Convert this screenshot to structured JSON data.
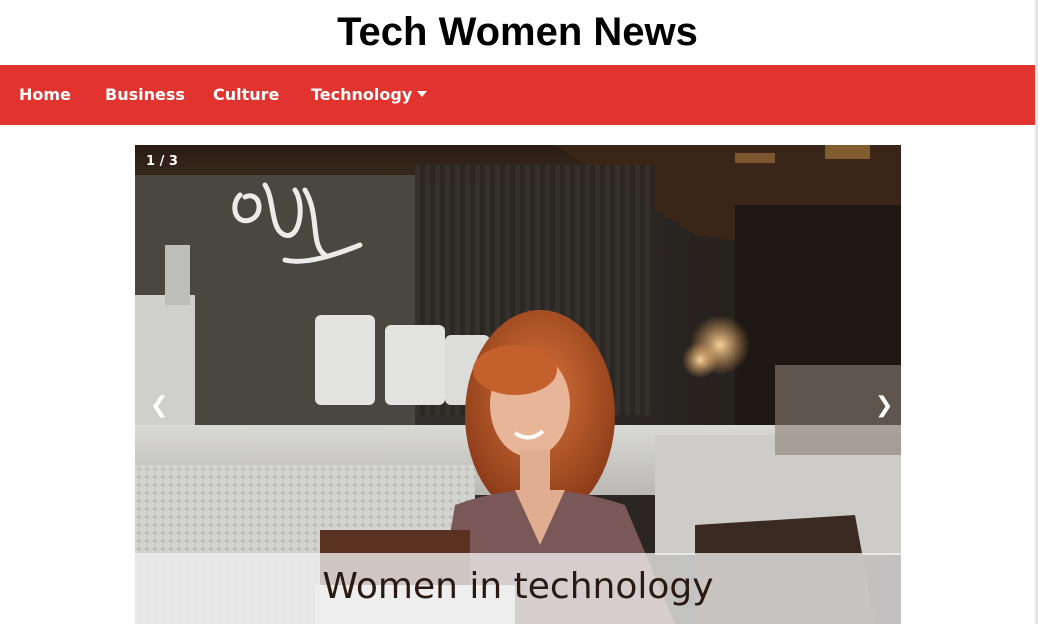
{
  "header": {
    "title": "Tech Women News"
  },
  "nav": {
    "items": [
      {
        "label": "Home"
      },
      {
        "label": "Business"
      },
      {
        "label": "Culture"
      },
      {
        "label": "Technology",
        "icon": "caret-down-icon"
      }
    ],
    "background_color": "#e2342f"
  },
  "slideshow": {
    "counter": "1 / 3",
    "prev_arrow": "❮",
    "next_arrow": "❯",
    "caption": "Women in technology",
    "image_description": "photo"
  }
}
